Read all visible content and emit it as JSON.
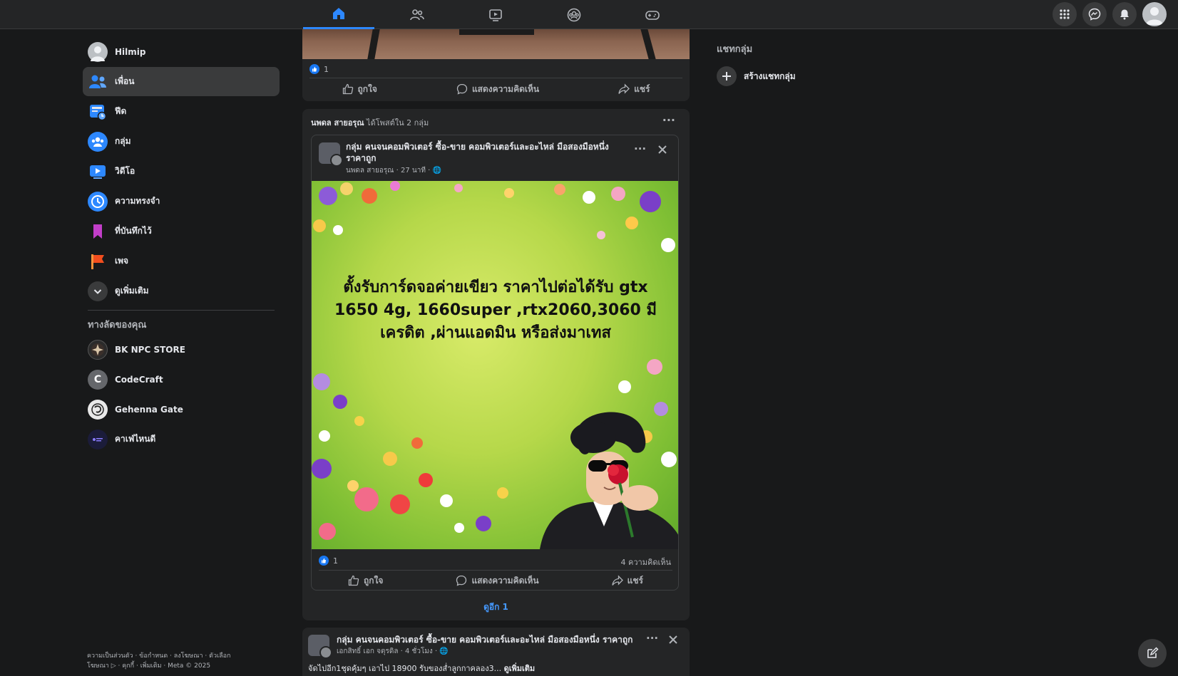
{
  "nav": {
    "tabs": [
      {
        "name": "home",
        "icon": "home-icon",
        "active": true
      },
      {
        "name": "friends",
        "icon": "friends-icon",
        "active": false
      },
      {
        "name": "video",
        "icon": "video-icon",
        "active": false
      },
      {
        "name": "groups",
        "icon": "groups-icon",
        "active": false
      },
      {
        "name": "gaming",
        "icon": "gaming-icon",
        "active": false
      }
    ],
    "right_icons": [
      "menu-grid-icon",
      "messenger-icon",
      "bell-icon",
      "profile-avatar"
    ]
  },
  "sidebar": {
    "items": [
      {
        "label": "Hilmip",
        "icon": "profile-avatar"
      },
      {
        "label": "เพื่อน",
        "icon": "friends-icon"
      },
      {
        "label": "ฟีด",
        "icon": "feed-icon"
      },
      {
        "label": "กลุ่ม",
        "icon": "groups-icon"
      },
      {
        "label": "วิดีโอ",
        "icon": "video-icon"
      },
      {
        "label": "ความทรงจำ",
        "icon": "memories-icon"
      },
      {
        "label": "ที่บันทึกไว้",
        "icon": "saved-icon"
      },
      {
        "label": "เพจ",
        "icon": "pages-flag-icon"
      },
      {
        "label": "ดูเพิ่มเติม",
        "icon": "chevron-down-icon"
      }
    ],
    "shortcuts_title": "ทางลัดของคุณ",
    "shortcuts": [
      {
        "label": "BK NPC STORE"
      },
      {
        "label": "CodeCraft",
        "initial": "C"
      },
      {
        "label": "Gehenna Gate"
      },
      {
        "label": "คาเฟ่ไหนดี"
      }
    ],
    "footer_line1": "ความเป็นส่วนตัว · ข้อกำหนด · ลงโฆษณา · ตัวเลือก",
    "footer_line2": "โฆษณา ▷ · คุกกี้ · เพิ่มเติม · Meta © 2025"
  },
  "post1": {
    "like_count": "1",
    "like_label": "ถูกใจ",
    "comment_label": "แสดงความคิดเห็น",
    "share_label": "แชร์"
  },
  "post2": {
    "author": "นพดล สายอรุณ",
    "posted_in": "ได้โพสต์ใน 2 กลุ่ม",
    "group_name": "กลุ่ม คนจนคอมพิวเตอร์ ซื้อ-ขาย คอมพิวเตอร์และอะไหล่ มือสองมือหนึ่ง ราคาถูก",
    "sub": "นพดล สายอรุณ · 27 นาที · 🌐",
    "image_text": "ตั้งรับการ์ดจอค่ายเขียว ราคาไปต่อได้รับ gtx 1650 4g, 1660super ,rtx2060,3060 มี เครดิต ,ผ่านแอดมิน หรือส่งมาเทส",
    "like_count": "1",
    "comment_count": "4 ความคิดเห็น",
    "like_label": "ถูกใจ",
    "comment_label": "แสดงความคิดเห็น",
    "share_label": "แชร์",
    "see_more": "ดูอีก 1"
  },
  "post3": {
    "group_name": "กลุ่ม คนจนคอมพิวเตอร์ ซื้อ-ขาย คอมพิวเตอร์และอะไหล่ มือสองมือหนึ่ง ราคาถูก",
    "sub": "เอกสิทธิ์ เอก จตุรดิล · 4 ชั่วโมง · 🌐",
    "preview": "จัดไปอีก1ชุดคุ้มๆ เอาไป 18900 รับของส่ำลูกกาคลอง3...",
    "see_more": "ดูเพิ่มเติม"
  },
  "right_panel": {
    "title": "แชทกลุ่ม",
    "create_label": "สร้างแชทกลุ่ม"
  },
  "colors": {
    "background": "#18191a",
    "surface": "#242526",
    "accent": "#2d88ff",
    "text": "#e4e6eb",
    "muted": "#b0b3b8"
  }
}
